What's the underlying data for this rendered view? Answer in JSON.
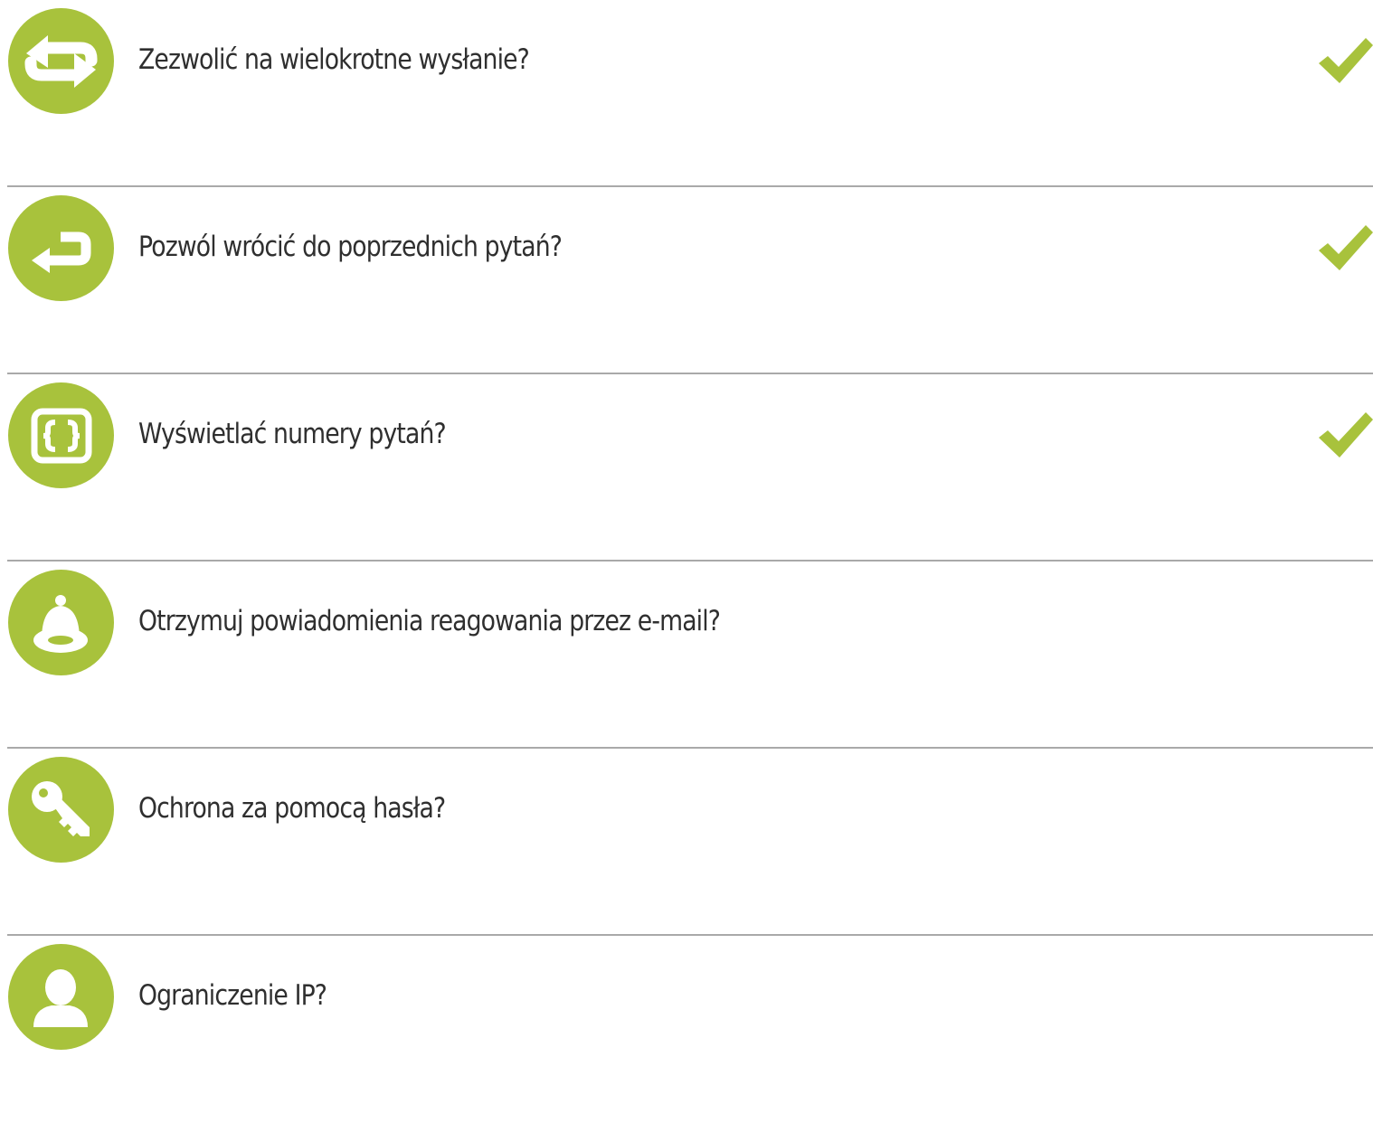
{
  "settings": {
    "accent_color": "#a8c23c",
    "items": [
      {
        "icon": "repeat-icon",
        "label": "Zezwolić na wielokrotne wysłanie?",
        "checked": true
      },
      {
        "icon": "return-arrow-icon",
        "label": "Pozwól wrócić do poprzednich pytań?",
        "checked": true
      },
      {
        "icon": "braces-icon",
        "label": "Wyświetlać numery pytań?",
        "checked": true
      },
      {
        "icon": "bell-icon",
        "label": "Otrzymuj powiadomienia reagowania przez e-mail?",
        "checked": false
      },
      {
        "icon": "key-icon",
        "label": "Ochrona za pomocą hasła?",
        "checked": false
      },
      {
        "icon": "user-icon",
        "label": "Ograniczenie IP?",
        "checked": false
      }
    ]
  }
}
